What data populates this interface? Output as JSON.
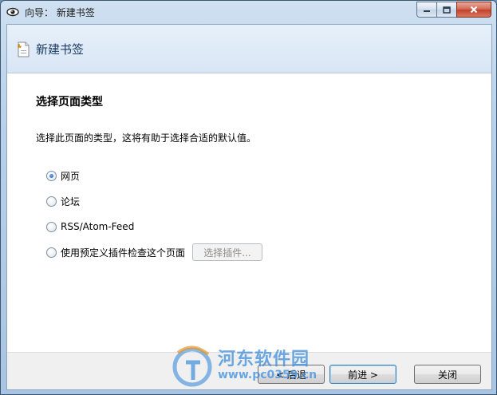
{
  "window": {
    "title": "向导： 新建书签"
  },
  "header": {
    "title": "新建书签"
  },
  "page": {
    "section_title": "选择页面类型",
    "description": "选择此页面的类型，这将有助于选择合适的默认值。"
  },
  "options": [
    {
      "label": "网页",
      "checked": true
    },
    {
      "label": "论坛",
      "checked": false
    },
    {
      "label": "RSS/Atom-Feed",
      "checked": false
    },
    {
      "label": "使用预定义插件检查这个页面",
      "checked": false
    }
  ],
  "plugin_button": {
    "label": "选择插件..."
  },
  "buttons": {
    "back": "< 后退",
    "next": "前进 >",
    "close": "关闭"
  },
  "watermark": {
    "title": "河东软件园",
    "url": "www.pc0359.cn"
  },
  "colors": {
    "accent": "#1550b8",
    "header_text": "#1c3a63",
    "watermark": "#3c8cdc"
  }
}
